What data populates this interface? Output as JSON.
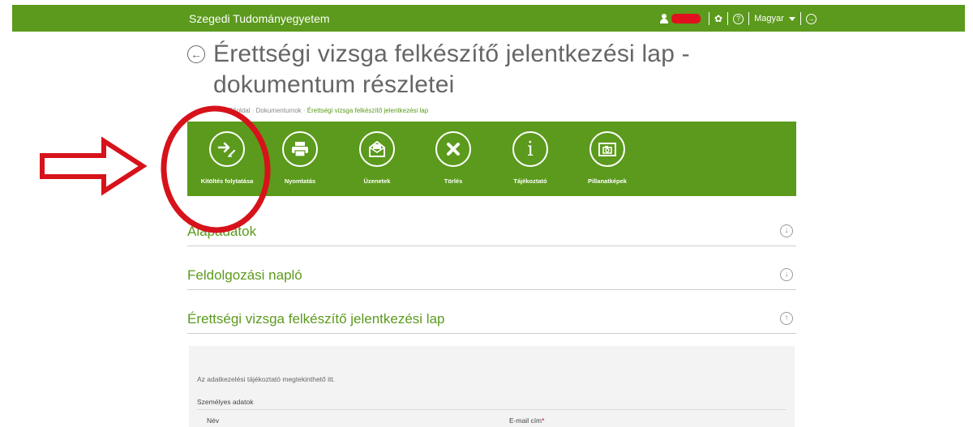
{
  "topbar": {
    "university": "Szegedi Tudományegyetem",
    "language": "Magyar",
    "help_glyph": "?",
    "logout_glyph": "→"
  },
  "page": {
    "title": "Érettségi vizsga felkészítő jelentkezési lap - dokumentum részletei"
  },
  "breadcrumb": {
    "ellipsis": "···",
    "home": "Főoldal",
    "documents": "Dokumentumok",
    "current": "Érettségi vizsga felkészítő jelentkezési lap",
    "separator": "·"
  },
  "toolbar": {
    "buttons": [
      {
        "label": "Kitöltés folytatása",
        "icon": "continue-fill-icon"
      },
      {
        "label": "Nyomtatás",
        "icon": "printer-icon"
      },
      {
        "label": "Üzenetek",
        "icon": "messages-icon"
      },
      {
        "label": "Törlés",
        "icon": "delete-icon"
      },
      {
        "label": "Tájékoztató",
        "icon": "info-icon"
      },
      {
        "label": "Pillanatképek",
        "icon": "snapshot-icon"
      }
    ]
  },
  "sections": [
    {
      "title": "Alapadatok",
      "toggle": "↓"
    },
    {
      "title": "Feldolgozási napló",
      "toggle": "↓"
    },
    {
      "title": "Érettségi vizsga felkészítő jelentkezési lap",
      "toggle": "↑"
    }
  ],
  "form": {
    "info_text": "Az adatkezelési tájékoztató megtekinthető itt.",
    "personal_heading": "Személyes adatok",
    "name_label": "Név",
    "email_label": "E-mail cím",
    "required_mark": "*"
  },
  "colors": {
    "brand_green": "#5b9a1c",
    "annotation_red": "#d7121b"
  }
}
